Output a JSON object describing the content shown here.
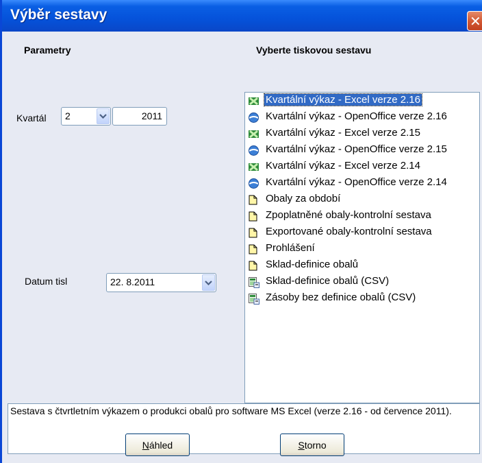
{
  "window": {
    "title": "Výběr sestavy",
    "close_glyph": "✕"
  },
  "params": {
    "heading": "Parametry",
    "quarter_label": "Kvartál",
    "quarter_value": "2",
    "year_value": "2011",
    "print_date_label": "Datum tisl",
    "print_date_value": "22. 8.2011"
  },
  "reports": {
    "heading": "Vyberte tiskovou sestavu",
    "items": [
      {
        "label": "Kvartální výkaz - Excel verze 2.16",
        "icon": "excel-icon",
        "selected": true
      },
      {
        "label": "Kvartální výkaz - OpenOffice verze 2.16",
        "icon": "openoffice-icon"
      },
      {
        "label": "Kvartální výkaz - Excel verze 2.15",
        "icon": "excel-icon"
      },
      {
        "label": "Kvartální výkaz - OpenOffice verze 2.15",
        "icon": "openoffice-icon"
      },
      {
        "label": "Kvartální výkaz - Excel verze 2.14",
        "icon": "excel-icon"
      },
      {
        "label": "Kvartální výkaz - OpenOffice verze 2.14",
        "icon": "openoffice-icon"
      },
      {
        "label": "Obaly za období",
        "icon": "document-icon"
      },
      {
        "label": "Zpoplatněné obaly-kontrolní sestava",
        "icon": "document-icon"
      },
      {
        "label": "Exportované obaly-kontrolní sestava",
        "icon": "document-icon"
      },
      {
        "label": "Prohlášení",
        "icon": "document-icon"
      },
      {
        "label": "Sklad-definice obalů",
        "icon": "document-icon"
      },
      {
        "label": "Sklad-definice obalů (CSV)",
        "icon": "csv-icon"
      },
      {
        "label": "Zásoby bez definice obalů (CSV)",
        "icon": "csv-icon"
      }
    ]
  },
  "description": "Sestava s čtvrtletním výkazem o produkci obalů pro software MS Excel (verze 2.16 - od července 2011).",
  "buttons": {
    "preview_key": "N",
    "preview_rest": "áhled",
    "cancel_key": "S",
    "cancel_rest": "torno"
  }
}
